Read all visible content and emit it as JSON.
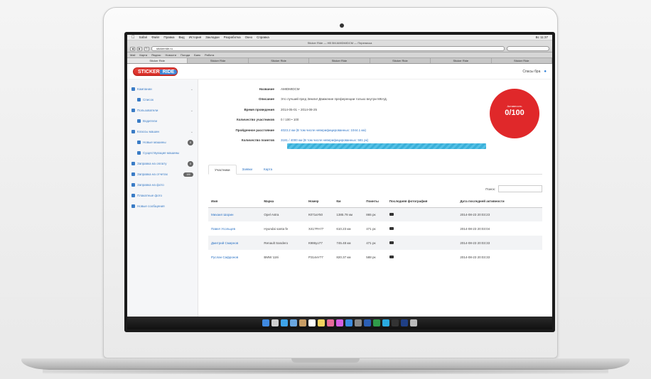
{
  "os_menubar": {
    "items": [
      "Safari",
      "Файл",
      "Правка",
      "Вид",
      "История",
      "Закладки",
      "Разработка",
      "Окно",
      "Справка"
    ],
    "status": "Вс 11:37"
  },
  "browser": {
    "title": "Sticker Ride — HB 5M AMIDMIDCM — Переписка",
    "url": "stickerride.ru",
    "bookmarks": [
      "Mail",
      "Карта",
      "Яндекс",
      "Новости",
      "Погода",
      "Банк",
      "Работа"
    ],
    "tabs": [
      "Sticker Ride",
      "Sticker Ride",
      "Sticker Ride",
      "Sticker Ride",
      "Sticker Ride",
      "Sticker Ride",
      "Sticker Ride"
    ]
  },
  "app": {
    "logo_main": "STICKER",
    "logo_rest": "RIDE",
    "user": "Спасы бра",
    "sidebar": [
      {
        "label": "Кампании",
        "sub": false,
        "arrow": true
      },
      {
        "label": "Список",
        "sub": true
      },
      {
        "label": "Пользователи",
        "sub": false,
        "arrow": true
      },
      {
        "label": "Водители",
        "sub": true
      },
      {
        "label": "Классы машин",
        "sub": false,
        "arrow": true
      },
      {
        "label": "Новые машины",
        "sub": true,
        "badge": "0"
      },
      {
        "label": "Существующие машины",
        "sub": true
      },
      {
        "label": "Заправка на оплату",
        "sub": false,
        "badge": "0"
      },
      {
        "label": "Заправка на отчетах",
        "sub": false,
        "pill": "100"
      },
      {
        "label": "Заправка на фото",
        "sub": false
      },
      {
        "label": "Плакатные фото",
        "sub": false
      },
      {
        "label": "Новые сообщения",
        "sub": false
      }
    ],
    "info": {
      "name_label": "Название",
      "name_value": "AMIDMIDCM",
      "desc_label": "Описание",
      "desc_value": "Это лучший пред Земли! Движение преференции только внутри МКАД.",
      "period_label": "Время проведения",
      "period_value": "2014-05-01 – 2014-08-25",
      "participants_label": "Количество участников",
      "participants_value": "0 / 100 • 100",
      "mileage_label": "Пройденное расстояние",
      "mileage_value": "4023.2 км (В том числе неверифицированных: 1044.1 км)",
      "points_label": "Количество поинтов",
      "points_value": "3181 / 4000 км (В том числе неверифицированных: 581 рк)",
      "progress": 1.0,
      "circle_small": "Активность",
      "circle_value": "0/100"
    },
    "subtabs": [
      "Участники",
      "Заявки",
      "Карта"
    ],
    "search_label": "Поиск:",
    "table": {
      "headers": [
        "Имя",
        "Марка",
        "Номер",
        "Км",
        "Поинты",
        "Последняя фотография",
        "Дата последней активности"
      ],
      "rows": [
        [
          "Михаил Шорин",
          "Opel Astra",
          "К071кУ50",
          "1385.78 км",
          "865 рк",
          "2014-08-23 20:03:23"
        ],
        [
          "Павел Усольцев",
          "Hyundai santa fe",
          "Х417РА77",
          "610.23 км",
          "471 рк",
          "2014-08-23 20:03:04"
        ],
        [
          "Дмитрий Смирнов",
          "Renault Sandero",
          "К986уо77",
          "745.48 км",
          "471 рк",
          "2014-08-23 20:03:33"
        ],
        [
          "Руслан Сафронов",
          "BMW 118i",
          "Р314еУ77",
          "820.37 км",
          "588 рк",
          "2014-08-23 20:03:33"
        ]
      ]
    }
  },
  "colors": {
    "accent": "#2b72c4",
    "circle": "#e0282a",
    "progress": "#56c1e6",
    "logo_red": "#e8423b",
    "logo_blue": "#3d86d6"
  },
  "dock_icons": [
    "finder-icon",
    "launchpad-icon",
    "safari-icon",
    "mail-icon",
    "contacts-icon",
    "calendar-icon",
    "notes-icon",
    "photos-icon",
    "itunes-icon",
    "appstore-icon",
    "preferences-icon",
    "word-icon",
    "excel-icon",
    "skype-icon",
    "terminal-icon",
    "photoshop-icon",
    "trash-icon"
  ],
  "dock_colors": [
    "#3f89e0",
    "#cfcfcf",
    "#3ea3e8",
    "#6aa7e0",
    "#c89d65",
    "#ffffff",
    "#f4d35e",
    "#e66a9a",
    "#d55fe2",
    "#3b8be0",
    "#8a8a8a",
    "#2b5fb5",
    "#2f9b4a",
    "#2aaae0",
    "#333333",
    "#1f3f85",
    "#bbbbbb"
  ]
}
